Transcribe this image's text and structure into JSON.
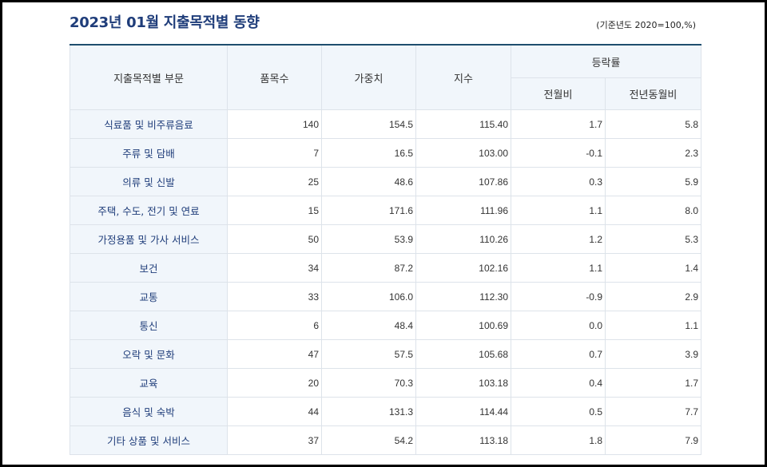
{
  "title": "2023년 01월 지출목적별 동향",
  "base_note": "(기준년도 2020=100,%)",
  "table": {
    "headers": {
      "category": "지출목적별 부문",
      "items": "품목수",
      "weight": "가중치",
      "index": "지수",
      "change_group": "등락률",
      "mom": "전월비",
      "yoy": "전년동월비"
    },
    "rows": [
      {
        "category": "식료품 및 비주류음료",
        "items": "140",
        "weight": "154.5",
        "index": "115.40",
        "mom": "1.7",
        "yoy": "5.8"
      },
      {
        "category": "주류 및 담배",
        "items": "7",
        "weight": "16.5",
        "index": "103.00",
        "mom": "-0.1",
        "yoy": "2.3"
      },
      {
        "category": "의류 및 신발",
        "items": "25",
        "weight": "48.6",
        "index": "107.86",
        "mom": "0.3",
        "yoy": "5.9"
      },
      {
        "category": "주택, 수도, 전기 및 연료",
        "items": "15",
        "weight": "171.6",
        "index": "111.96",
        "mom": "1.1",
        "yoy": "8.0"
      },
      {
        "category": "가정용품 및 가사 서비스",
        "items": "50",
        "weight": "53.9",
        "index": "110.26",
        "mom": "1.2",
        "yoy": "5.3"
      },
      {
        "category": "보건",
        "items": "34",
        "weight": "87.2",
        "index": "102.16",
        "mom": "1.1",
        "yoy": "1.4"
      },
      {
        "category": "교통",
        "items": "33",
        "weight": "106.0",
        "index": "112.30",
        "mom": "-0.9",
        "yoy": "2.9"
      },
      {
        "category": "통신",
        "items": "6",
        "weight": "48.4",
        "index": "100.69",
        "mom": "0.0",
        "yoy": "1.1"
      },
      {
        "category": "오락 및 문화",
        "items": "47",
        "weight": "57.5",
        "index": "105.68",
        "mom": "0.7",
        "yoy": "3.9"
      },
      {
        "category": "교육",
        "items": "20",
        "weight": "70.3",
        "index": "103.18",
        "mom": "0.4",
        "yoy": "1.7"
      },
      {
        "category": "음식 및 숙박",
        "items": "44",
        "weight": "131.3",
        "index": "114.44",
        "mom": "0.5",
        "yoy": "7.7"
      },
      {
        "category": "기타 상품 및 서비스",
        "items": "37",
        "weight": "54.2",
        "index": "113.18",
        "mom": "1.8",
        "yoy": "7.9"
      }
    ]
  },
  "colors": {
    "title": "#1f3d7a",
    "header_bg": "#f1f6fb",
    "top_rule": "#1f4e6e",
    "grid": "#dde3ea"
  }
}
